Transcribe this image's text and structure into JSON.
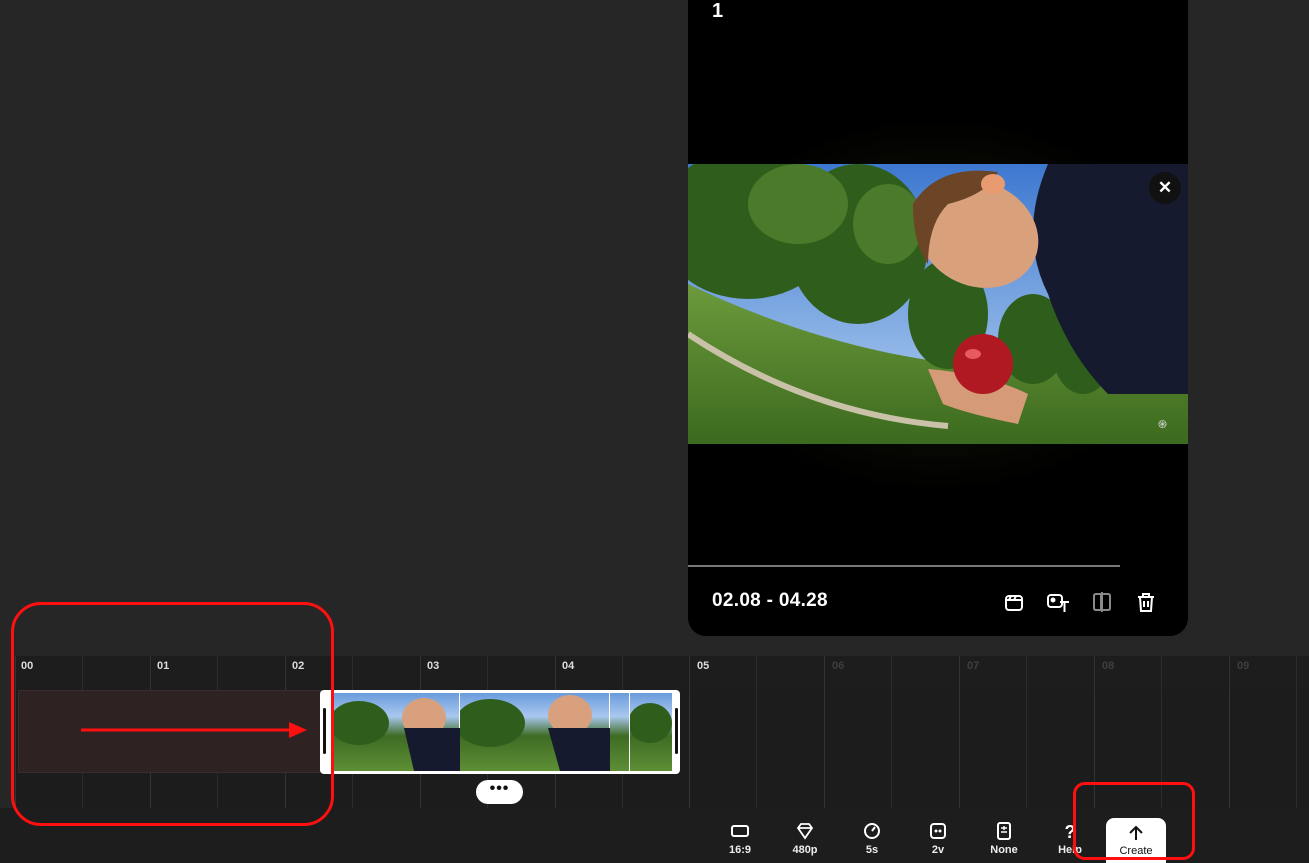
{
  "preview": {
    "index": "1",
    "time_range": "02.08 - 04.28",
    "close_glyph": "✕",
    "watermark_glyph": "֍",
    "tools": [
      "storyboard-icon",
      "caption-text-icon",
      "split-compare-icon",
      "trash-icon"
    ]
  },
  "timeline": {
    "ticks": [
      "00",
      "01",
      "02",
      "03",
      "04",
      "05",
      "06",
      "07",
      "08",
      "09"
    ],
    "more_glyph": "•••"
  },
  "toolbar": {
    "items": [
      {
        "icon": "aspect-ratio-icon",
        "label": "16:9"
      },
      {
        "icon": "diamond-quality-icon",
        "label": "480p"
      },
      {
        "icon": "timer-icon",
        "label": "5s"
      },
      {
        "icon": "variants-icon",
        "label": "2v"
      },
      {
        "icon": "style-preset-icon",
        "label": "None"
      },
      {
        "icon": "help-icon",
        "label": "Help"
      }
    ],
    "create_label": "Create"
  },
  "colors": {
    "background": "#262626",
    "annotation": "#ff1010",
    "empty_track": "#2e2223"
  }
}
